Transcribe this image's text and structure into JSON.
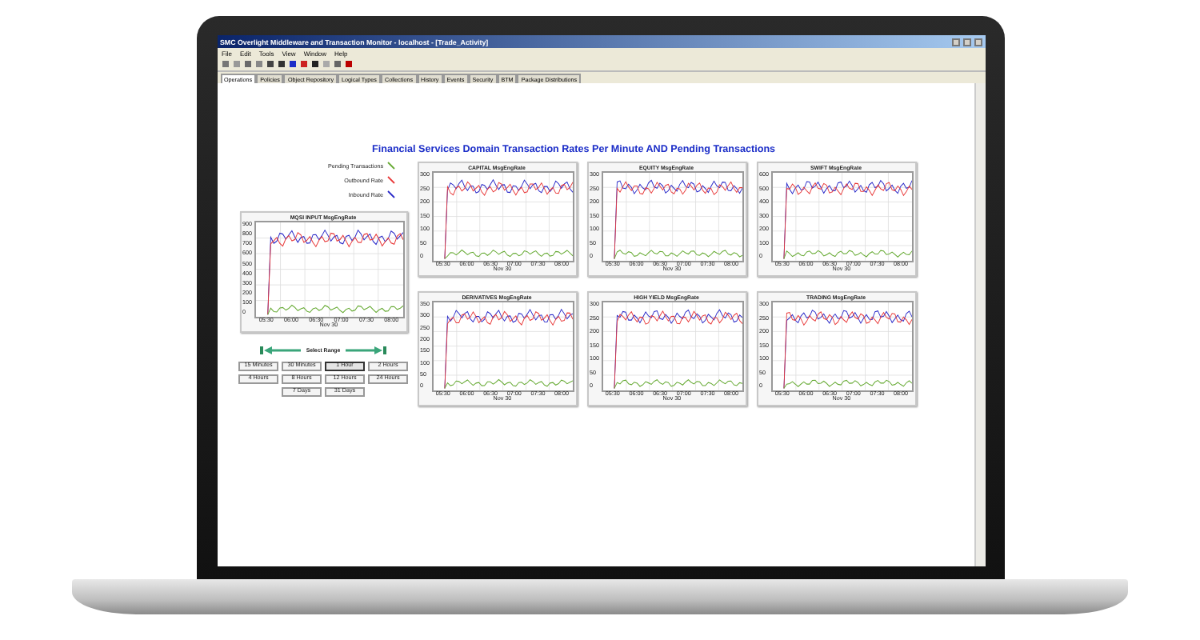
{
  "window": {
    "title": "SMC Overlight Middleware and Transaction Monitor - localhost - [Trade_Activity]"
  },
  "menu": [
    "File",
    "Edit",
    "Tools",
    "View",
    "Window",
    "Help"
  ],
  "tabs": [
    {
      "label": "Operations",
      "selected": true
    },
    {
      "label": "Policies",
      "selected": false
    },
    {
      "label": "Object Repository",
      "selected": false
    },
    {
      "label": "Logical Types",
      "selected": false
    },
    {
      "label": "Collections",
      "selected": false
    },
    {
      "label": "History",
      "selected": false
    },
    {
      "label": "Events",
      "selected": false
    },
    {
      "label": "Security",
      "selected": false
    },
    {
      "label": "BTM",
      "selected": false
    },
    {
      "label": "Package Distributions",
      "selected": false
    }
  ],
  "heading": "Financial Services Domain Transaction Rates Per Minute AND Pending Transactions",
  "legend": [
    {
      "label": "Pending Transactions",
      "color": "#66aa33"
    },
    {
      "label": "Outbound Rate",
      "color": "#e83838"
    },
    {
      "label": "Inbound Rate",
      "color": "#2828c8"
    }
  ],
  "side_chart": {
    "title": "MQSI INPUT MsgEngRate",
    "y_ticks": [
      "900",
      "800",
      "700",
      "600",
      "500",
      "400",
      "300",
      "200",
      "100",
      "0"
    ],
    "x_ticks": [
      "05:30",
      "06:00",
      "06:30",
      "07:00",
      "07:30",
      "08:00"
    ],
    "x_label": "Nov 30"
  },
  "charts": [
    {
      "title": "CAPITAL MsgEngRate",
      "y_ticks": [
        "300",
        "250",
        "200",
        "150",
        "100",
        "50",
        "0"
      ],
      "x_ticks": [
        "05:30",
        "06:00",
        "06:30",
        "07:00",
        "07:30",
        "08:00"
      ],
      "x_label": "Nov 30"
    },
    {
      "title": "EQUITY MsgEngRate",
      "y_ticks": [
        "300",
        "250",
        "200",
        "150",
        "100",
        "50",
        "0"
      ],
      "x_ticks": [
        "05:30",
        "06:00",
        "06:30",
        "07:00",
        "07:30",
        "08:00"
      ],
      "x_label": "Nov 30"
    },
    {
      "title": "SWIFT MsgEngRate",
      "y_ticks": [
        "600",
        "500",
        "400",
        "300",
        "200",
        "100",
        "0"
      ],
      "x_ticks": [
        "05:30",
        "06:00",
        "06:30",
        "07:00",
        "07:30",
        "08:00"
      ],
      "x_label": "Nov 30"
    },
    {
      "title": "DERIVATIVES MsgEngRate",
      "y_ticks": [
        "350",
        "300",
        "250",
        "200",
        "150",
        "100",
        "50",
        "0"
      ],
      "x_ticks": [
        "05:30",
        "06:00",
        "06:30",
        "07:00",
        "07:30",
        "08:00"
      ],
      "x_label": "Nov 30"
    },
    {
      "title": "HIGH YIELD MsgEngRate",
      "y_ticks": [
        "300",
        "250",
        "200",
        "150",
        "100",
        "50",
        "0"
      ],
      "x_ticks": [
        "05:30",
        "06:00",
        "06:30",
        "07:00",
        "07:30",
        "08:00"
      ],
      "x_label": "Nov 30"
    },
    {
      "title": "TRADING MsgEngRate",
      "y_ticks": [
        "300",
        "250",
        "200",
        "150",
        "100",
        "50",
        "0"
      ],
      "x_ticks": [
        "05:30",
        "06:00",
        "06:30",
        "07:00",
        "07:30",
        "08:00"
      ],
      "x_label": "Nov 30"
    }
  ],
  "range": {
    "label": "Select Range",
    "buttons": [
      [
        {
          "label": "15 Minutes",
          "selected": false
        },
        {
          "label": "30 Minutes",
          "selected": false
        },
        {
          "label": "1 Hour",
          "selected": true
        },
        {
          "label": "2 Hours",
          "selected": false
        }
      ],
      [
        {
          "label": "4 Hours",
          "selected": false
        },
        {
          "label": "8 Hours",
          "selected": false
        },
        {
          "label": "12 Hours",
          "selected": false
        },
        {
          "label": "24 Hours",
          "selected": false
        }
      ],
      [
        {
          "label": "7 Days",
          "selected": false
        },
        {
          "label": "31 Days",
          "selected": false
        }
      ]
    ]
  }
}
